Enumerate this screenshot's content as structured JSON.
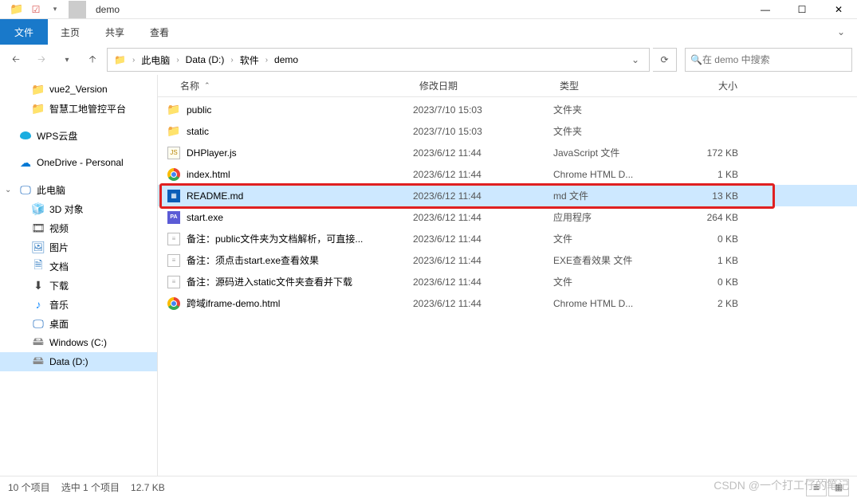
{
  "window": {
    "title": "demo",
    "min": "—",
    "max": "☐",
    "close": "✕"
  },
  "ribbon": {
    "file": "文件",
    "tabs": [
      "主页",
      "共享",
      "查看"
    ]
  },
  "breadcrumbs": [
    "此电脑",
    "Data (D:)",
    "软件",
    "demo"
  ],
  "search": {
    "placeholder": "在 demo 中搜索"
  },
  "sidebar": {
    "top": [
      {
        "icon": "folder",
        "label": "vue2_Version"
      },
      {
        "icon": "folder",
        "label": "智慧工地管控平台"
      }
    ],
    "clouds": [
      {
        "icon": "cloud-wps",
        "label": "WPS云盘"
      },
      {
        "icon": "cloud-blue",
        "label": "OneDrive - Personal"
      }
    ],
    "pc": {
      "label": "此电脑",
      "expanded": true
    },
    "pc_children": [
      {
        "icon": "box3d",
        "label": "3D 对象"
      },
      {
        "icon": "video-ico",
        "label": "视频"
      },
      {
        "icon": "pic-ico",
        "label": "图片"
      },
      {
        "icon": "doc-ico",
        "label": "文档"
      },
      {
        "icon": "dl-ico",
        "label": "下载"
      },
      {
        "icon": "music-ico",
        "label": "音乐"
      },
      {
        "icon": "desk-ico",
        "label": "桌面"
      },
      {
        "icon": "drive-ico",
        "label": "Windows (C:)"
      },
      {
        "icon": "drive-ico",
        "label": "Data (D:)",
        "selected": true
      }
    ]
  },
  "columns": {
    "name": "名称",
    "date": "修改日期",
    "type": "类型",
    "size": "大小"
  },
  "files": [
    {
      "icon": "folder-ico",
      "name": "public",
      "date": "2023/7/10 15:03",
      "type": "文件夹",
      "size": ""
    },
    {
      "icon": "folder-ico",
      "name": "static",
      "date": "2023/7/10 15:03",
      "type": "文件夹",
      "size": ""
    },
    {
      "icon": "js-ico",
      "glyph": "JS",
      "name": "DHPlayer.js",
      "date": "2023/6/12 11:44",
      "type": "JavaScript 文件",
      "size": "172 KB"
    },
    {
      "icon": "chrome-ico",
      "name": "index.html",
      "date": "2023/6/12 11:44",
      "type": "Chrome HTML D...",
      "size": "1 KB"
    },
    {
      "icon": "md-ico",
      "glyph": "▦",
      "name": "README.md",
      "date": "2023/6/12 11:44",
      "type": "md 文件",
      "size": "13 KB",
      "selected": true
    },
    {
      "icon": "exe-ico",
      "glyph": "PA",
      "name": "start.exe",
      "date": "2023/6/12 11:44",
      "type": "应用程序",
      "size": "264 KB"
    },
    {
      "icon": "txt-ico",
      "glyph": "≡",
      "name": "备注：public文件夹为文档解析，可直接...",
      "date": "2023/6/12 11:44",
      "type": "文件",
      "size": "0 KB"
    },
    {
      "icon": "txt-ico",
      "glyph": "≡",
      "name": "备注：须点击start.exe查看效果",
      "date": "2023/6/12 11:44",
      "type": "EXE查看效果 文件",
      "size": "1 KB"
    },
    {
      "icon": "txt-ico",
      "glyph": "≡",
      "name": "备注：源码进入static文件夹查看并下载",
      "date": "2023/6/12 11:44",
      "type": "文件",
      "size": "0 KB"
    },
    {
      "icon": "chrome-ico",
      "name": "跨域iframe-demo.html",
      "date": "2023/6/12 11:44",
      "type": "Chrome HTML D...",
      "size": "2 KB"
    }
  ],
  "status": {
    "count": "10 个项目",
    "selected": "选中 1 个项目",
    "size": "12.7 KB"
  },
  "watermark": "CSDN @一个打工仔的笔记"
}
